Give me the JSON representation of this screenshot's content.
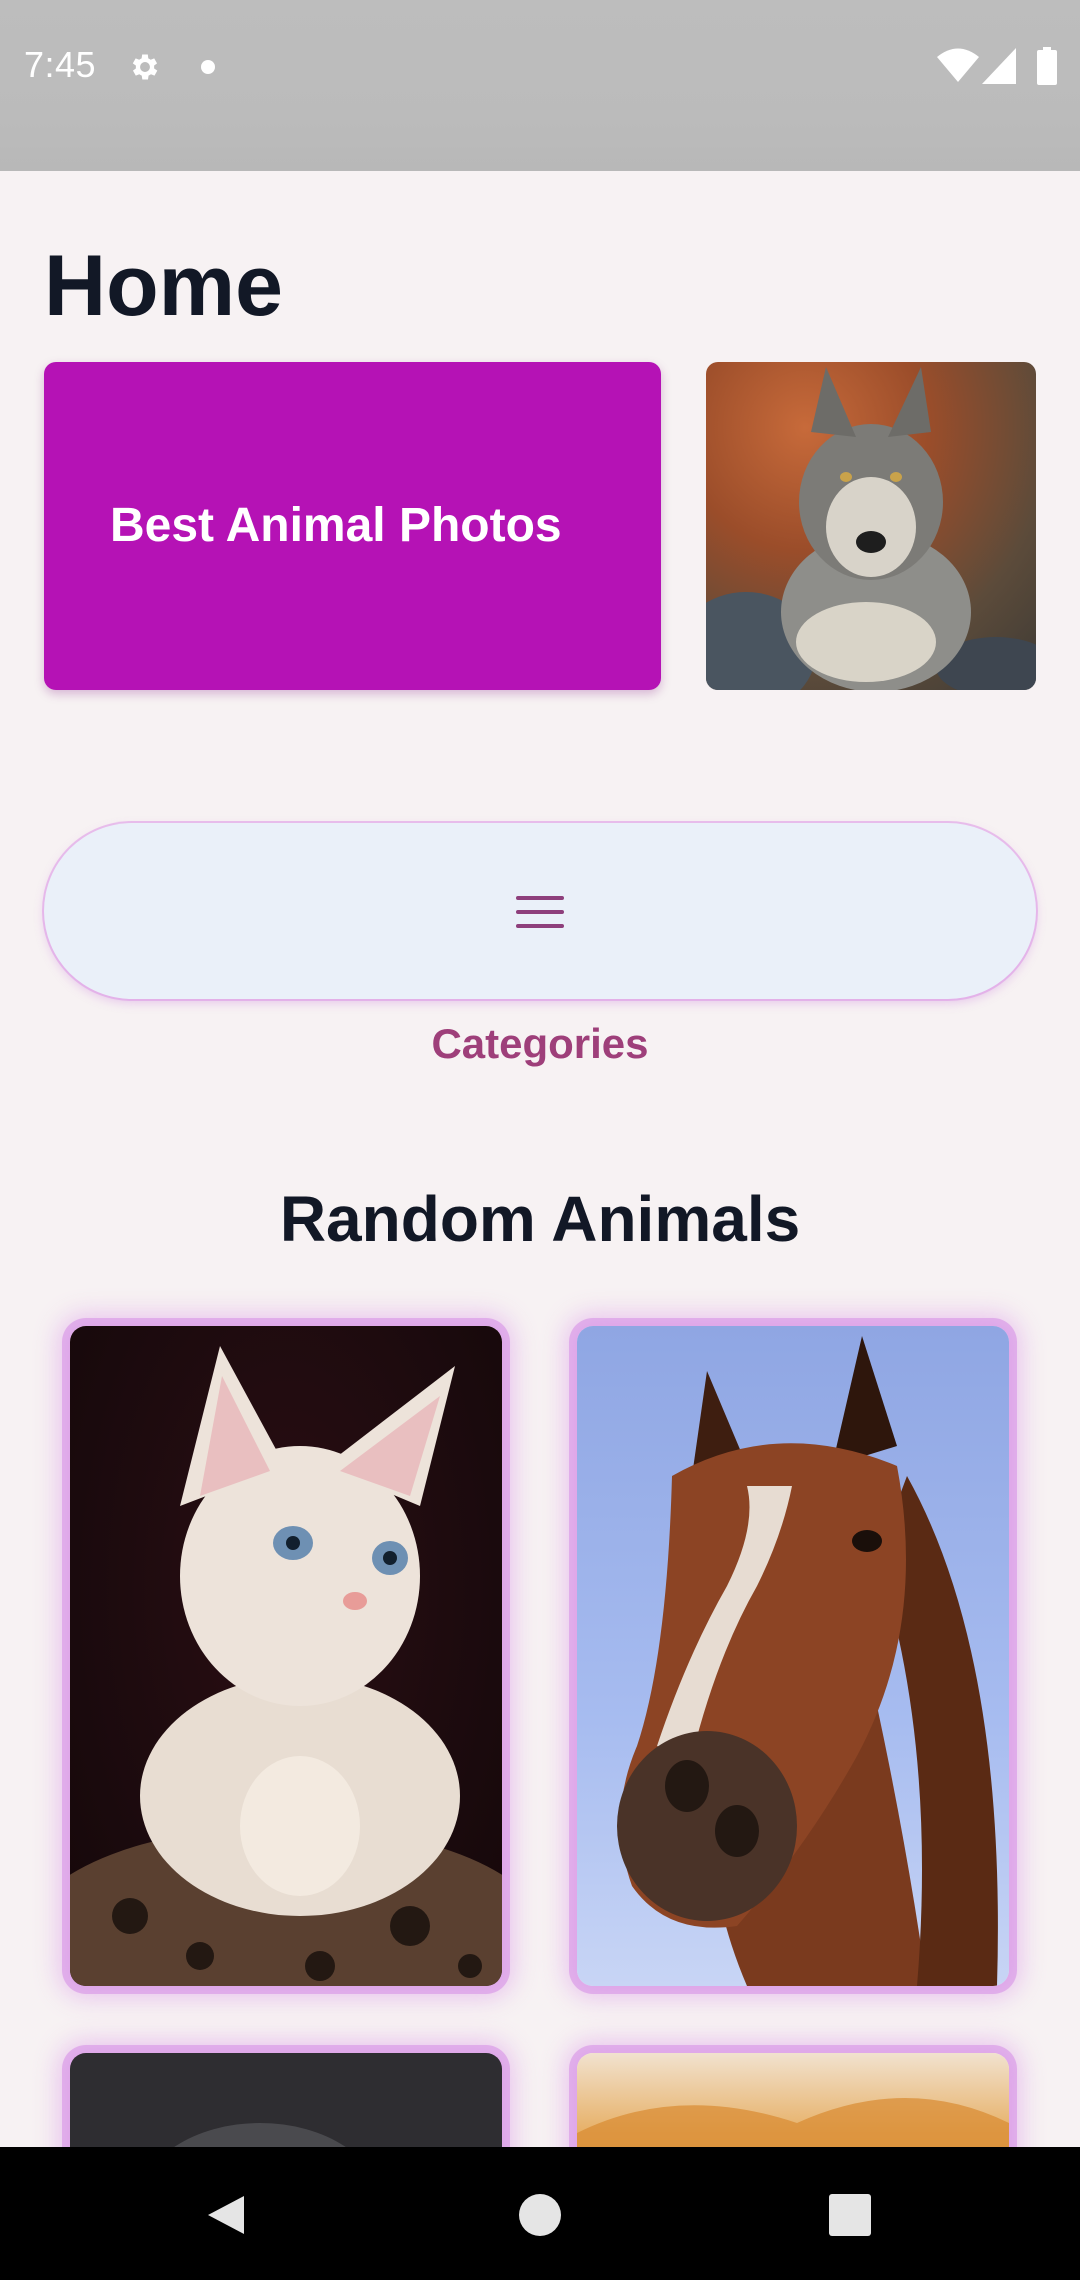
{
  "status_bar": {
    "time": "7:45",
    "icons": [
      "gear-icon",
      "notification-dot-icon",
      "wifi-icon",
      "cell-signal-icon",
      "battery-icon"
    ]
  },
  "header": {
    "title": "Home"
  },
  "featured": {
    "title": "Best Animal Photos",
    "photo": "wolf-photo"
  },
  "categories": {
    "icon": "menu-icon",
    "label": "Categories"
  },
  "random_animals": {
    "title": "Random Animals",
    "photos": [
      "cat-photo",
      "horse-photo",
      "dog-photo",
      "lion-photo"
    ]
  },
  "nav_bar": {
    "icons": [
      "back-icon",
      "home-icon",
      "recents-icon"
    ]
  },
  "colors": {
    "background": "#F7F2F3",
    "featured_card": "#B512B5",
    "categories_button": "#EAF0F9",
    "accent_text": "#9E3F7A",
    "title_text": "#121826"
  }
}
